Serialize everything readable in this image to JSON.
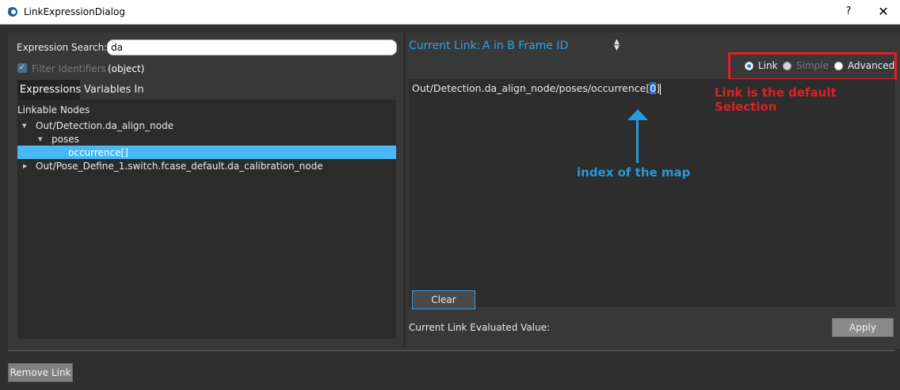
{
  "window": {
    "title": "LinkExpressionDialog",
    "help_label": "?",
    "close_label": "✕"
  },
  "search": {
    "label": "Expression Search:",
    "value": "da",
    "filter_label": "Filter Identifiers",
    "filter_checked": true,
    "object_label": "(object)"
  },
  "tabs": [
    {
      "label": "Expressions",
      "active": true
    },
    {
      "label": "Variables In",
      "active": false
    }
  ],
  "tree": {
    "header": "Linkable Nodes",
    "rows": [
      {
        "label": "Out/Detection.da_align_node",
        "expanded": true
      },
      {
        "label": "poses",
        "expanded": true
      },
      {
        "label": "occurrence[]",
        "selected": true
      },
      {
        "label": "Out/Pose_Define_1.switch.fcase_default.da_calibration_node",
        "expanded": false
      }
    ]
  },
  "current_link": {
    "label": "Current Link:",
    "value": "A in B Frame ID"
  },
  "modes": {
    "options": [
      {
        "label": "Link",
        "selected": true,
        "enabled": true
      },
      {
        "label": "Simple",
        "selected": false,
        "enabled": false
      },
      {
        "label": "Advanced",
        "selected": false,
        "enabled": true
      }
    ]
  },
  "expression": {
    "prefix": "Out/Detection.da_align_node/poses/occurrence[",
    "highlight": "0",
    "suffix": "]"
  },
  "annotations": {
    "red_note": "Link is the default Selection",
    "blue_note": "index of the map",
    "red_color": "#e01f26",
    "blue_color": "#2899d8"
  },
  "buttons": {
    "clear": "Clear",
    "apply": "Apply",
    "remove_link": "Remove Link"
  },
  "evaluated": {
    "label": "Current Link Evaluated Value:"
  },
  "colors": {
    "accent": "#2fa3e0",
    "selection": "#49b8f5",
    "background": "#2f2f2f"
  }
}
